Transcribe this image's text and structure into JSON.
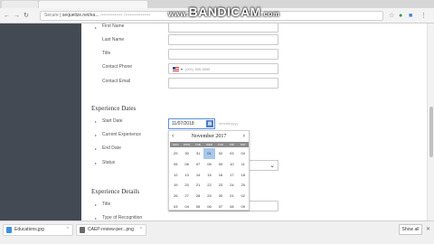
{
  "browser": {
    "url_secure_label": "Secure",
    "url_text": "| sequelize.net/ea...",
    "url_blurred": "•••••••••••••• /••••••••••••••••",
    "watermark_www": "www.",
    "watermark_brand": "BANDICAM",
    "watermark_tld": ".com"
  },
  "form": {
    "contact": {
      "first_name_label": "First Name",
      "last_name_label": "Last Name",
      "title_label": "Title",
      "phone_label": "Contact Phone",
      "phone_placeholder": "(201) 555-5555",
      "email_label": "Contact Email"
    },
    "experience_dates": {
      "title": "Experience Dates",
      "start_date_label": "Start Date",
      "start_date_value": "11/07/2018",
      "start_date_hint": "mm/dd/yyyy",
      "current_experience_label": "Current Experience",
      "end_date_label": "End Date",
      "status_label": "Status"
    },
    "experience_details": {
      "title": "Experience Details",
      "title_field_label": "Title",
      "type_label": "Type of Recognition"
    }
  },
  "calendar": {
    "month_year": "November 2017",
    "prev_label": "‹",
    "next_label": "›",
    "weekdays": [
      "SUN",
      "MON",
      "TUE",
      "WED",
      "THU",
      "FRI",
      "SAT"
    ],
    "days": [
      "29",
      "30",
      "31",
      "01",
      "02",
      "03",
      "04",
      "05",
      "06",
      "07",
      "08",
      "09",
      "10",
      "11",
      "12",
      "13",
      "14",
      "15",
      "16",
      "17",
      "18",
      "19",
      "20",
      "21",
      "22",
      "23",
      "24",
      "25",
      "26",
      "27",
      "28",
      "29",
      "30",
      "01",
      "02",
      "03",
      "04",
      "05",
      "06",
      "07",
      "08",
      "09"
    ],
    "selected_index": 3
  },
  "downloads": {
    "item1": "Educations.jpg",
    "item2": "CAEP-review-per...png",
    "show_all": "Show all"
  }
}
